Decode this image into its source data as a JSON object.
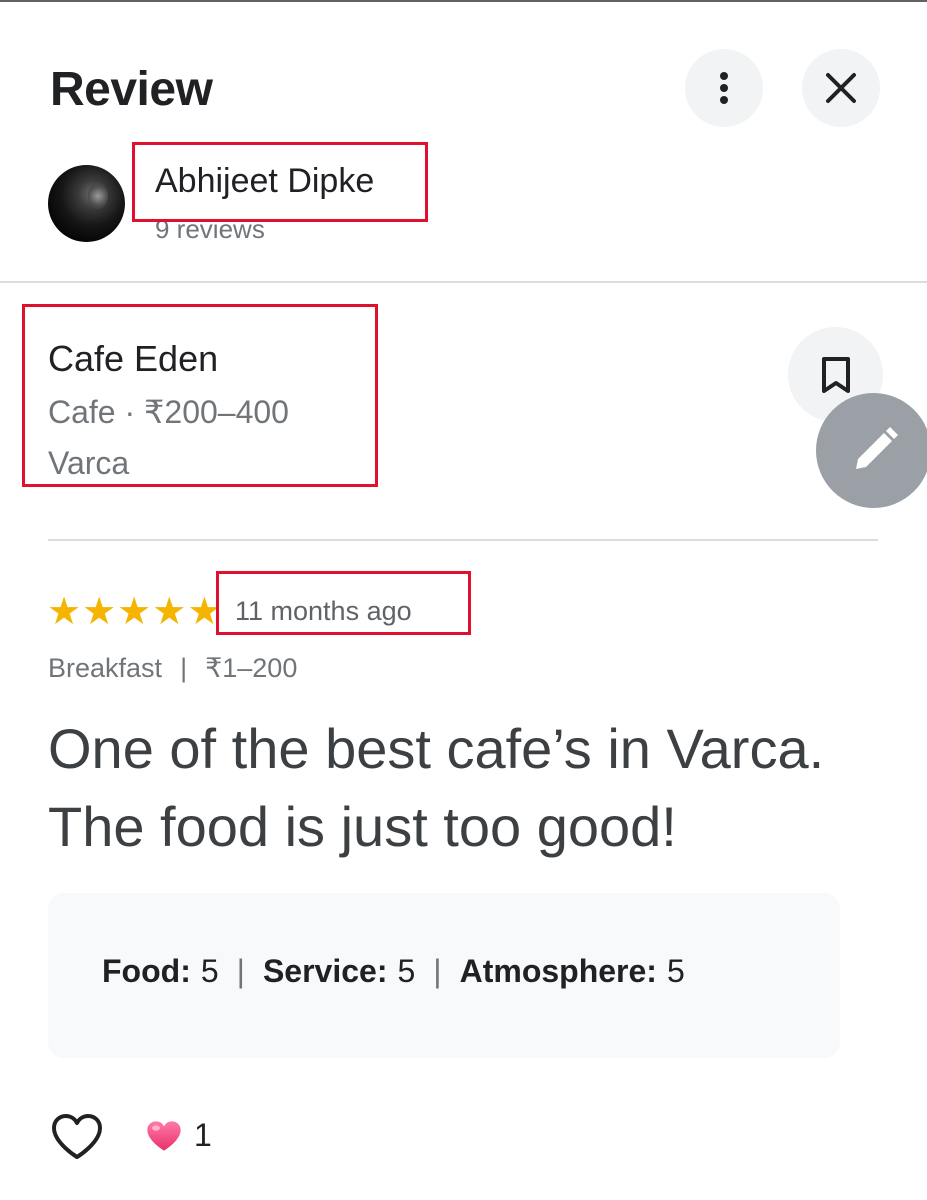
{
  "header": {
    "title": "Review",
    "more_icon": "more-vert-icon",
    "close_icon": "close-icon"
  },
  "author": {
    "name": "Abhijeet Dipke",
    "reviews_count": "9 reviews"
  },
  "place": {
    "name": "Cafe Eden",
    "category_price": "Cafe · ₹200–400",
    "location": "Varca",
    "save_icon": "bookmark-icon",
    "edit_icon": "pencil-icon"
  },
  "review": {
    "stars": 5,
    "time_ago": "11 months ago",
    "meal": "Breakfast",
    "separator": "|",
    "price_per_person": "₹1–200",
    "text": "One of the best cafe’s in Varca. The food is just too good!"
  },
  "ratings": [
    {
      "label": "Food:",
      "value": "5"
    },
    {
      "label": "Service:",
      "value": "5"
    },
    {
      "label": "Atmosphere:",
      "value": "5"
    }
  ],
  "reactions": {
    "like_icon": "heart-outline-icon",
    "reaction_icon": "pink-heart-icon",
    "count": "1"
  },
  "colors": {
    "highlight": "#e0102f",
    "star": "#f4b400",
    "fab": "#9aa0a6",
    "secondary_text": "#70757a"
  }
}
